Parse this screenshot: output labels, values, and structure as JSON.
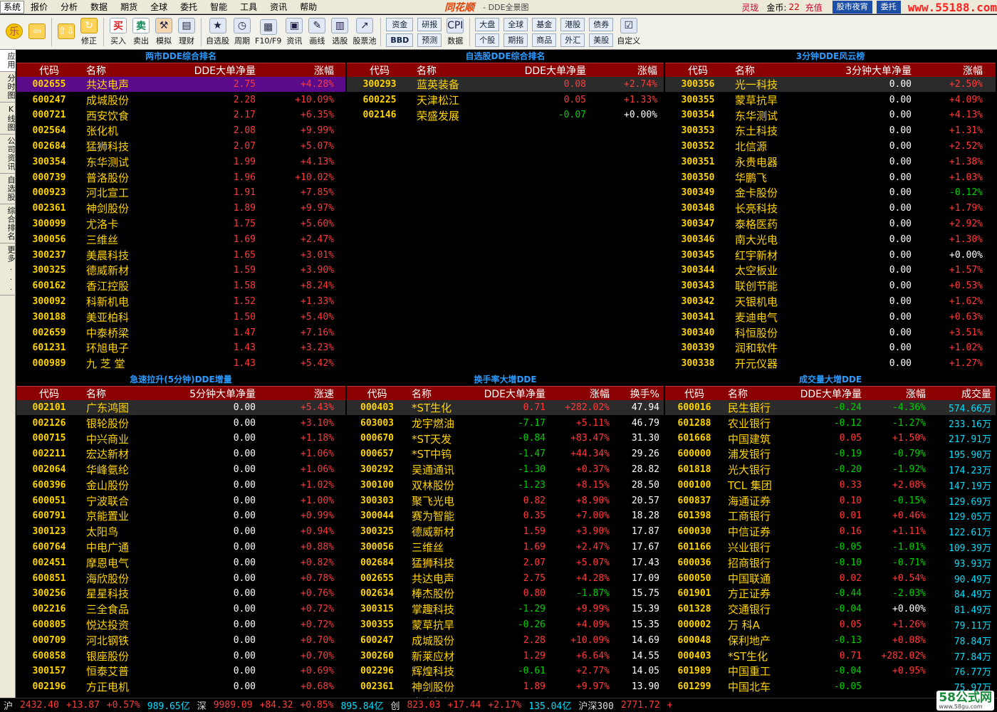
{
  "menu": [
    "系统",
    "报价",
    "分析",
    "数据",
    "期货",
    "全球",
    "委托",
    "智能",
    "工具",
    "资讯",
    "帮助"
  ],
  "brand": "同花顺",
  "subtitle": "- DDE全景图",
  "menu_right": {
    "link1": "灵珑",
    "coin_label": "金币:",
    "coin_value": "22",
    "recharge": "充值",
    "btn1": "股市夜宵",
    "btn2": "委托",
    "watermark": "www.55188.com"
  },
  "toolbar": {
    "buttons": [
      {
        "label": "",
        "icon": "乐"
      },
      {
        "label": "",
        "icon": "⇦"
      },
      {
        "label": "",
        "icon": "⇧⇩"
      },
      {
        "label": "修正",
        "icon": "↻"
      },
      {
        "label": "买入",
        "icon": "买"
      },
      {
        "label": "卖出",
        "icon": "卖"
      },
      {
        "label": "模拟",
        "icon": "⚒"
      },
      {
        "label": "理财",
        "icon": "▤"
      },
      {
        "label": "自选股",
        "icon": "★"
      },
      {
        "label": "周期",
        "icon": "◷"
      },
      {
        "label": "F10/F9",
        "icon": "▦"
      },
      {
        "label": "资讯",
        "icon": "▣"
      },
      {
        "label": "画线",
        "icon": "✎"
      },
      {
        "label": "选股",
        "icon": "▥"
      },
      {
        "label": "股票池",
        "icon": "↗"
      }
    ],
    "groups": [
      [
        "资金",
        "BBD"
      ],
      [
        "研报",
        "预测"
      ]
    ],
    "data_btn": "数据",
    "cpi": "CPI",
    "groups2": [
      [
        "大盘",
        "个股"
      ],
      [
        "全球",
        "期指"
      ],
      [
        "基金",
        "商品"
      ],
      [
        "港股",
        "外汇"
      ],
      [
        "债券",
        "美股"
      ]
    ],
    "custom": "自定义"
  },
  "sidebar": [
    "应用",
    "分时图",
    "K线图",
    "公司资讯",
    "自选股",
    "综合排名",
    "更多..."
  ],
  "panel1": {
    "title": "两市DDE综合排名",
    "headers": [
      "代码",
      "名称",
      "DDE大单净量",
      "涨幅"
    ],
    "rows": [
      [
        "002655",
        "共达电声",
        "2.75",
        "+4.28%"
      ],
      [
        "600247",
        "成城股份",
        "2.28",
        "+10.09%"
      ],
      [
        "000721",
        "西安饮食",
        "2.17",
        "+6.35%"
      ],
      [
        "002564",
        "张化机",
        "2.08",
        "+9.99%"
      ],
      [
        "002684",
        "猛狮科技",
        "2.07",
        "+5.07%"
      ],
      [
        "300354",
        "东华测试",
        "1.99",
        "+4.13%"
      ],
      [
        "000739",
        "普洛股份",
        "1.96",
        "+10.02%"
      ],
      [
        "000923",
        "河北宣工",
        "1.91",
        "+7.85%"
      ],
      [
        "002361",
        "神剑股份",
        "1.89",
        "+9.97%"
      ],
      [
        "300099",
        "尤洛卡",
        "1.75",
        "+5.60%"
      ],
      [
        "300056",
        "三维丝",
        "1.69",
        "+2.47%"
      ],
      [
        "300237",
        "美晨科技",
        "1.65",
        "+3.01%"
      ],
      [
        "300325",
        "德威新材",
        "1.59",
        "+3.90%"
      ],
      [
        "600162",
        "香江控股",
        "1.58",
        "+8.24%"
      ],
      [
        "300092",
        "科新机电",
        "1.52",
        "+1.33%"
      ],
      [
        "300188",
        "美亚柏科",
        "1.50",
        "+5.40%"
      ],
      [
        "002659",
        "中泰桥梁",
        "1.47",
        "+7.16%"
      ],
      [
        "601231",
        "环旭电子",
        "1.43",
        "+3.23%"
      ],
      [
        "000989",
        "九 芝 堂",
        "1.43",
        "+5.42%"
      ]
    ]
  },
  "panel2": {
    "title": "自选股DDE综合排名",
    "headers": [
      "代码",
      "名称",
      "DDE大单净量",
      "涨幅"
    ],
    "rows": [
      [
        "300293",
        "蓝英装备",
        "0.08",
        "+2.74%"
      ],
      [
        "600225",
        "天津松江",
        "0.05",
        "+1.33%"
      ],
      [
        "002146",
        "荣盛发展",
        "-0.07",
        "+0.00%"
      ]
    ]
  },
  "panel3": {
    "title": "3分钟DDE风云榜",
    "headers": [
      "代码",
      "名称",
      "3分钟大单净量",
      "涨幅"
    ],
    "rows": [
      [
        "300356",
        "光一科技",
        "0.00",
        "+2.50%"
      ],
      [
        "300355",
        "蒙草抗旱",
        "0.00",
        "+4.09%"
      ],
      [
        "300354",
        "东华测试",
        "0.00",
        "+4.13%"
      ],
      [
        "300353",
        "东土科技",
        "0.00",
        "+1.31%"
      ],
      [
        "300352",
        "北信源",
        "0.00",
        "+2.52%"
      ],
      [
        "300351",
        "永贵电器",
        "0.00",
        "+1.38%"
      ],
      [
        "300350",
        "华鹏飞",
        "0.00",
        "+1.03%"
      ],
      [
        "300349",
        "金卡股份",
        "0.00",
        "-0.12%"
      ],
      [
        "300348",
        "长亮科技",
        "0.00",
        "+1.79%"
      ],
      [
        "300347",
        "泰格医药",
        "0.00",
        "+2.92%"
      ],
      [
        "300346",
        "南大光电",
        "0.00",
        "+1.30%"
      ],
      [
        "300345",
        "红宇新材",
        "0.00",
        "+0.00%"
      ],
      [
        "300344",
        "太空板业",
        "0.00",
        "+1.57%"
      ],
      [
        "300343",
        "联创节能",
        "0.00",
        "+0.53%"
      ],
      [
        "300342",
        "天银机电",
        "0.00",
        "+1.62%"
      ],
      [
        "300341",
        "麦迪电气",
        "0.00",
        "+0.63%"
      ],
      [
        "300340",
        "科恒股份",
        "0.00",
        "+3.51%"
      ],
      [
        "300339",
        "润和软件",
        "0.00",
        "+1.02%"
      ],
      [
        "300338",
        "开元仪器",
        "0.00",
        "+1.27%"
      ]
    ]
  },
  "panel4": {
    "title": "急速拉升(5分钟)DDE增量",
    "headers": [
      "代码",
      "名称",
      "5分钟大单净量",
      "涨速"
    ],
    "rows": [
      [
        "002101",
        "广东鸿图",
        "0.00",
        "+5.43%"
      ],
      [
        "002126",
        "银轮股份",
        "0.00",
        "+3.10%"
      ],
      [
        "000715",
        "中兴商业",
        "0.00",
        "+1.18%"
      ],
      [
        "002211",
        "宏达新材",
        "0.00",
        "+1.06%"
      ],
      [
        "002064",
        "华峰氨纶",
        "0.00",
        "+1.06%"
      ],
      [
        "600396",
        "金山股份",
        "0.00",
        "+1.02%"
      ],
      [
        "600051",
        "宁波联合",
        "0.00",
        "+1.00%"
      ],
      [
        "600791",
        "京能置业",
        "0.00",
        "+0.99%"
      ],
      [
        "300123",
        "太阳鸟",
        "0.00",
        "+0.94%"
      ],
      [
        "600764",
        "中电广通",
        "0.00",
        "+0.88%"
      ],
      [
        "002451",
        "摩恩电气",
        "0.00",
        "+0.82%"
      ],
      [
        "600851",
        "海欣股份",
        "0.00",
        "+0.78%"
      ],
      [
        "300256",
        "星星科技",
        "0.00",
        "+0.76%"
      ],
      [
        "002216",
        "三全食品",
        "0.00",
        "+0.72%"
      ],
      [
        "600805",
        "悦达投资",
        "0.00",
        "+0.72%"
      ],
      [
        "000709",
        "河北钢铁",
        "0.00",
        "+0.70%"
      ],
      [
        "600858",
        "银座股份",
        "0.00",
        "+0.70%"
      ],
      [
        "300157",
        "恒泰艾普",
        "0.00",
        "+0.69%"
      ],
      [
        "002196",
        "方正电机",
        "0.00",
        "+0.68%"
      ]
    ]
  },
  "panel5": {
    "title": "换手率大增DDE",
    "headers": [
      "代码",
      "名称",
      "DDE大单净量",
      "涨幅",
      "换手%"
    ],
    "rows": [
      [
        "000403",
        "*ST生化",
        "0.71",
        "+282.02%",
        "47.94"
      ],
      [
        "603003",
        "龙宇燃油",
        "-7.17",
        "+5.11%",
        "46.79"
      ],
      [
        "000670",
        "*ST天发",
        "-0.84",
        "+83.47%",
        "31.30"
      ],
      [
        "000657",
        "*ST中钨",
        "-1.47",
        "+44.34%",
        "29.26"
      ],
      [
        "300292",
        "吴通通讯",
        "-1.30",
        "+0.37%",
        "28.82"
      ],
      [
        "300100",
        "双林股份",
        "-1.23",
        "+8.15%",
        "28.50"
      ],
      [
        "300303",
        "聚飞光电",
        "0.82",
        "+8.90%",
        "20.57"
      ],
      [
        "300044",
        "赛为智能",
        "0.35",
        "+7.00%",
        "18.28"
      ],
      [
        "300325",
        "德威新材",
        "1.59",
        "+3.90%",
        "17.87"
      ],
      [
        "300056",
        "三维丝",
        "1.69",
        "+2.47%",
        "17.67"
      ],
      [
        "002684",
        "猛狮科技",
        "2.07",
        "+5.07%",
        "17.43"
      ],
      [
        "002655",
        "共达电声",
        "2.75",
        "+4.28%",
        "17.09"
      ],
      [
        "002634",
        "棒杰股份",
        "0.80",
        "-1.87%",
        "15.75"
      ],
      [
        "300315",
        "掌趣科技",
        "-1.29",
        "+9.99%",
        "15.39"
      ],
      [
        "300355",
        "蒙草抗旱",
        "-0.26",
        "+4.09%",
        "15.35"
      ],
      [
        "600247",
        "成城股份",
        "2.28",
        "+10.09%",
        "14.69"
      ],
      [
        "300260",
        "新莱应材",
        "1.29",
        "+6.64%",
        "14.55"
      ],
      [
        "002296",
        "辉煌科技",
        "-0.61",
        "+2.77%",
        "14.05"
      ],
      [
        "002361",
        "神剑股份",
        "1.89",
        "+9.97%",
        "13.90"
      ],
      [
        "002659",
        "中泰桥梁",
        "1.47",
        "+7.16%",
        "13.67"
      ]
    ]
  },
  "panel6": {
    "title": "成交量大增DDE",
    "headers": [
      "代码",
      "名称",
      "DDE大单净量",
      "涨幅",
      "成交量"
    ],
    "rows": [
      [
        "600016",
        "民生银行",
        "-0.24",
        "-4.36%",
        "574.66万"
      ],
      [
        "601288",
        "农业银行",
        "-0.12",
        "-1.27%",
        "233.16万"
      ],
      [
        "601668",
        "中国建筑",
        "0.05",
        "+1.50%",
        "217.91万"
      ],
      [
        "600000",
        "浦发银行",
        "-0.19",
        "-0.79%",
        "195.90万"
      ],
      [
        "601818",
        "光大银行",
        "-0.20",
        "-1.92%",
        "174.23万"
      ],
      [
        "000100",
        "TCL 集团",
        "0.33",
        "+2.08%",
        "147.19万"
      ],
      [
        "600837",
        "海通证券",
        "0.10",
        "-0.15%",
        "129.69万"
      ],
      [
        "601398",
        "工商银行",
        "0.01",
        "+0.46%",
        "129.05万"
      ],
      [
        "600030",
        "中信证券",
        "0.16",
        "+1.11%",
        "122.61万"
      ],
      [
        "601166",
        "兴业银行",
        "-0.05",
        "-1.01%",
        "109.39万"
      ],
      [
        "600036",
        "招商银行",
        "-0.10",
        "-0.71%",
        "93.93万"
      ],
      [
        "600050",
        "中国联通",
        "0.02",
        "+0.54%",
        "90.49万"
      ],
      [
        "601901",
        "方正证券",
        "-0.44",
        "-2.03%",
        "84.49万"
      ],
      [
        "601328",
        "交通银行",
        "-0.04",
        "+0.00%",
        "81.49万"
      ],
      [
        "000002",
        "万 科A",
        "0.05",
        "+1.26%",
        "79.11万"
      ],
      [
        "600048",
        "保利地产",
        "-0.13",
        "+0.08%",
        "78.84万"
      ],
      [
        "000403",
        "*ST生化",
        "0.71",
        "+282.02%",
        "77.84万"
      ],
      [
        "601989",
        "中国重工",
        "-0.04",
        "+0.95%",
        "76.77万"
      ],
      [
        "601299",
        "中国北车",
        "-0.05",
        "",
        "75.97万"
      ]
    ]
  },
  "status": {
    "sh_label": "沪",
    "sh_index": "2432.40",
    "sh_chg": "+13.87",
    "sh_pct": "+0.57%",
    "sh_amt": "989.65亿",
    "sz_label": "深",
    "sz_index": "9989.09",
    "sz_chg": "+84.32",
    "sz_pct": "+0.85%",
    "sz_amt": "895.84亿",
    "cy_label": "创",
    "cy_index": "823.03",
    "cy_chg": "+17.44",
    "cy_pct": "+2.17%",
    "cy_amt": "135.04亿",
    "hs_label": "沪深300",
    "hs_index": "2771.72",
    "hs_chg": "+"
  },
  "logo": {
    "main": "58公式网",
    "sub": "www.58gu.com"
  }
}
